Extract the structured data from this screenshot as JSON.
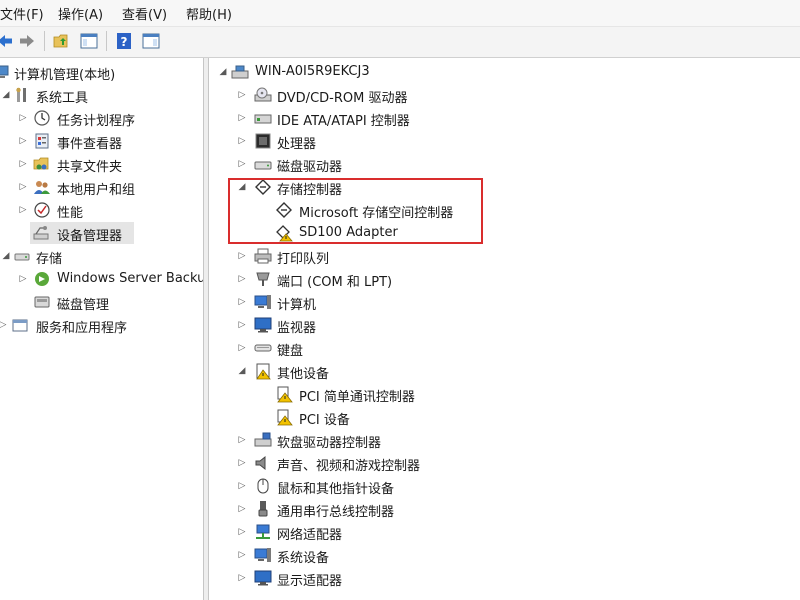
{
  "menubar": {
    "file": "文件(F)",
    "action": "操作(A)",
    "view": "查看(V)",
    "help": "帮助(H)"
  },
  "left_tree": {
    "root": "计算机管理(本地)",
    "system_tools": "系统工具",
    "task_scheduler": "任务计划程序",
    "event_viewer": "事件查看器",
    "shared_folders": "共享文件夹",
    "local_users_groups": "本地用户和组",
    "performance": "性能",
    "device_manager": "设备管理器",
    "storage": "存储",
    "windows_server_backup": "Windows Server Backup",
    "disk_management": "磁盘管理",
    "services_apps": "服务和应用程序"
  },
  "device_tree": {
    "computer_name": "WIN-A0I5R9EKCJ3",
    "dvd": "DVD/CD-ROM 驱动器",
    "ide": "IDE ATA/ATAPI 控制器",
    "processors": "处理器",
    "disk_drives": "磁盘驱动器",
    "storage_controllers": "存储控制器",
    "ms_storage_spaces": "Microsoft 存储空间控制器",
    "sd100": "SD100 Adapter",
    "print_queues": "打印队列",
    "ports": "端口 (COM 和 LPT)",
    "computer": "计算机",
    "monitors": "监视器",
    "keyboards": "键盘",
    "other_devices": "其他设备",
    "pci_simple_comm": "PCI 简单通讯控制器",
    "pci_device": "PCI 设备",
    "floppy_controllers": "软盘驱动器控制器",
    "sound_video_game": "声音、视频和游戏控制器",
    "mice": "鼠标和其他指针设备",
    "usb_controllers": "通用串行总线控制器",
    "network_adapters": "网络适配器",
    "system_devices": "系统设备",
    "display_adapters": "显示适配器"
  },
  "colors": {
    "highlight_border": "#d92d2d",
    "selected_bg": "#e5e5e5",
    "warning": "#f2c200"
  }
}
